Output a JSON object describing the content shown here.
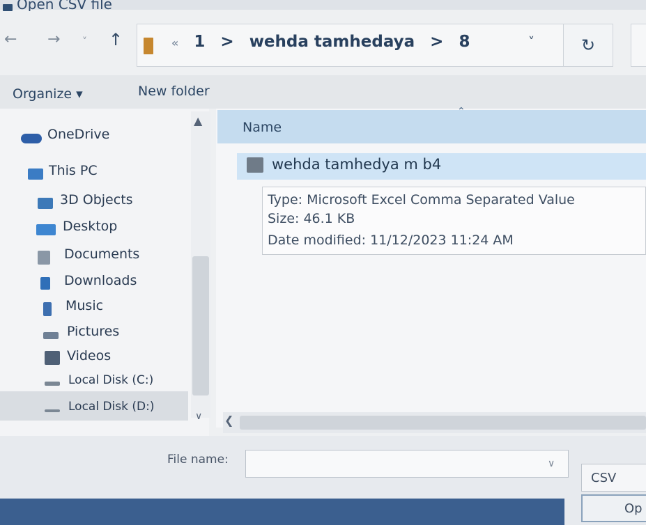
{
  "window": {
    "title": "Open CSV file"
  },
  "nav": {
    "back_icon": "←",
    "forward_icon": "→",
    "recent_icon": "˅",
    "up_icon": "↑",
    "breadcrumb_prefix": "«",
    "breadcrumbs": [
      "1",
      "wehda tamhedaya",
      "8"
    ],
    "separator": ">",
    "dropdown_icon": "˅",
    "refresh_icon": "↻"
  },
  "toolbar": {
    "organize": "Organize ▾",
    "new_folder": "New folder"
  },
  "sidebar": {
    "items": [
      {
        "label": "OneDrive",
        "icon": "cloud-icon",
        "color": "#2d5ea8"
      },
      {
        "label": "This PC",
        "icon": "computer-icon",
        "color": "#3b7cc4"
      },
      {
        "label": "3D Objects",
        "icon": "cube-icon",
        "color": "#3d79b8"
      },
      {
        "label": "Desktop",
        "icon": "desktop-icon",
        "color": "#3e86d1"
      },
      {
        "label": "Documents",
        "icon": "documents-icon",
        "color": "#8a97a6"
      },
      {
        "label": "Downloads",
        "icon": "download-icon",
        "color": "#2f6fb8"
      },
      {
        "label": "Music",
        "icon": "music-icon",
        "color": "#3d6fb0"
      },
      {
        "label": "Pictures",
        "icon": "pictures-icon",
        "color": "#6f8095"
      },
      {
        "label": "Videos",
        "icon": "videos-icon",
        "color": "#4f6076"
      },
      {
        "label": "Local Disk (C:)",
        "icon": "drive-icon",
        "color": "#7b8794"
      },
      {
        "label": "Local Disk (D:)",
        "icon": "drive-icon",
        "color": "#7b8794"
      }
    ]
  },
  "content": {
    "column_name": "Name",
    "file": {
      "name": "wehda tamhedya m b4"
    },
    "tooltip": {
      "type": "Type: Microsoft Excel Comma Separated Value",
      "size": "Size: 46.1 KB",
      "date": "Date modified: 11/12/2023 11:24 AM"
    }
  },
  "footer": {
    "file_name_label": "File name:",
    "file_name_value": "",
    "filter": "CSV",
    "open": "Op"
  }
}
